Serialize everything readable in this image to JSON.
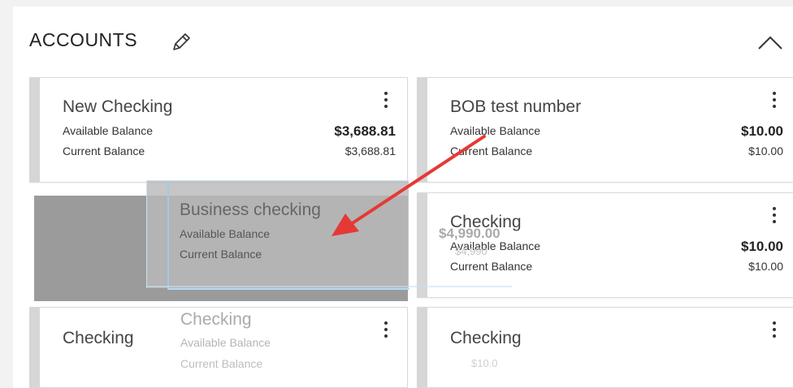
{
  "header": {
    "title": "ACCOUNTS"
  },
  "icons": {
    "edit": "pencil-icon",
    "collapse": "chevron-up-icon",
    "menu": "kebab-menu-icon"
  },
  "accounts": [
    {
      "name": "New Checking",
      "available_label": "Available Balance",
      "available": "$3,688.81",
      "current_label": "Current Balance",
      "current": "$3,688.81"
    },
    {
      "name": "BOB test number",
      "available_label": "Available Balance",
      "available": "$10.00",
      "current_label": "Current Balance",
      "current": "$10.00"
    },
    {
      "name": "Checking",
      "available_label": "Available Balance",
      "available": "$10.00",
      "current_label": "Current Balance",
      "current": "$10.00"
    },
    {
      "name": "Checking"
    },
    {
      "name": "Checking"
    }
  ],
  "dragging_card": {
    "name": "Business checking",
    "available_label": "Available Balance",
    "current_label": "Current Balance"
  },
  "ghost_card": {
    "name": "Checking",
    "available_label": "Available Balance",
    "current_label": "Current Balance"
  },
  "faint_values": {
    "a": "$4,990.00",
    "b": "$4,990",
    "c": "$10.0"
  },
  "colors": {
    "arrow": "#e53935",
    "placeholder": "#9b9b9b",
    "card_bar": "#d6d6d6"
  }
}
